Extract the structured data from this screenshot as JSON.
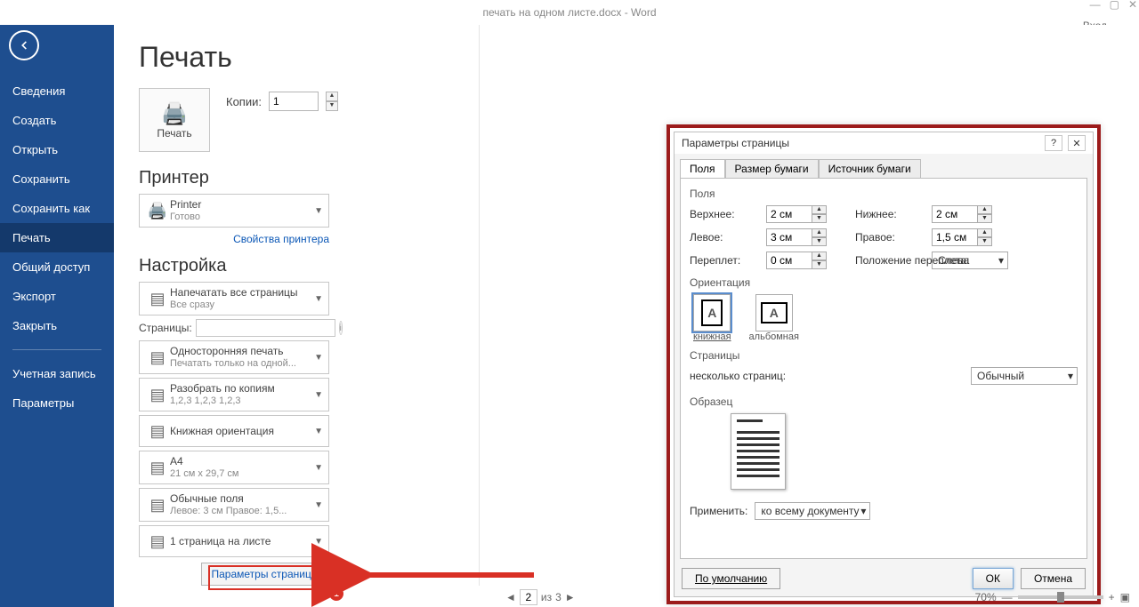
{
  "titlebar": {
    "doc": "печать на одном листе.docx - Word",
    "account": "Вход"
  },
  "sidebar": {
    "items": [
      "Сведения",
      "Создать",
      "Открыть",
      "Сохранить",
      "Сохранить как",
      "Печать",
      "Общий доступ",
      "Экспорт",
      "Закрыть"
    ],
    "account_item": "Учетная запись",
    "options_item": "Параметры",
    "active": 5
  },
  "print": {
    "title": "Печать",
    "print_button": "Печать",
    "copies_label": "Копии:",
    "copies": "1",
    "printer_heading": "Принтер",
    "printer_name": "Printer",
    "printer_status": "Готово",
    "printer_props": "Свойства принтера",
    "settings_heading": "Настройка",
    "settings": [
      {
        "title": "Напечатать все страницы",
        "sub": "Все сразу"
      },
      {
        "title": "Односторонняя печать",
        "sub": "Печатать только на одной..."
      },
      {
        "title": "Разобрать по копиям",
        "sub": "1,2,3    1,2,3    1,2,3"
      },
      {
        "title": "Книжная ориентация",
        "sub": ""
      },
      {
        "title": "A4",
        "sub": "21 см x 29,7 см"
      },
      {
        "title": "Обычные поля",
        "sub": "Левое: 3 см    Правое: 1,5..."
      },
      {
        "title": "1 страница на листе",
        "sub": ""
      }
    ],
    "pages_label": "Страницы:",
    "page_params": "Параметры страницы"
  },
  "dialog": {
    "title": "Параметры страницы",
    "tabs": [
      "Поля",
      "Размер бумаги",
      "Источник бумаги"
    ],
    "fields_label": "Поля",
    "fields": {
      "top": {
        "label": "Верхнее:",
        "value": "2 см"
      },
      "bottom": {
        "label": "Нижнее:",
        "value": "2 см"
      },
      "left": {
        "label": "Левое:",
        "value": "3 см"
      },
      "right": {
        "label": "Правое:",
        "value": "1,5 см"
      },
      "gutter": {
        "label": "Переплет:",
        "value": "0 см"
      },
      "gutter_pos": {
        "label": "Положение переплета:",
        "value": "Слева"
      }
    },
    "orient_label": "Ориентация",
    "orient": {
      "portrait": "книжная",
      "landscape": "альбомная"
    },
    "pages_label": "Страницы",
    "multi_label": "несколько страниц:",
    "multi_value": "Обычный",
    "sample_label": "Образец",
    "apply_label": "Применить:",
    "apply_value": "ко всему документу",
    "default_btn": "По умолчанию",
    "ok": "ОК",
    "cancel": "Отмена"
  },
  "footer": {
    "page_current": "2",
    "page_sep": "из",
    "page_total": "3",
    "zoom": "70%"
  },
  "callout": {
    "badge": "1"
  }
}
